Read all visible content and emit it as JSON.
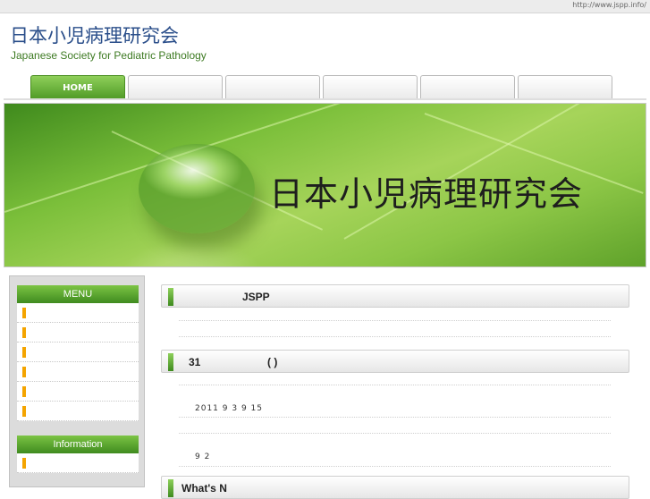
{
  "topbar": {
    "url": "http://www.jspp.info/"
  },
  "brand": {
    "title_jp": "日本小児病理研究会",
    "title_en": "Japanese Society for Pediatric Pathology"
  },
  "nav": {
    "tabs": [
      {
        "label": "HOME"
      },
      {
        "label": ""
      },
      {
        "label": ""
      },
      {
        "label": ""
      },
      {
        "label": ""
      },
      {
        "label": ""
      }
    ]
  },
  "hero": {
    "title": "日本小児病理研究会"
  },
  "sidebar": {
    "menu": {
      "title": "MENU",
      "items": [
        "",
        "",
        "",
        "",
        "",
        ""
      ]
    },
    "information": {
      "title": "Information",
      "items": [
        ""
      ]
    }
  },
  "content": {
    "sections": [
      {
        "title": "JSPP"
      },
      {
        "title_num": "31",
        "title_paren": "(   )"
      },
      {
        "title": "What's N"
      }
    ],
    "lines": {
      "date_line": "2011 9 3    9 15",
      "num_line": "9 2"
    }
  },
  "colors": {
    "accent_green": "#4f9a26",
    "bullet_orange": "#f4a400",
    "brand_blue": "#2a4e8a"
  }
}
